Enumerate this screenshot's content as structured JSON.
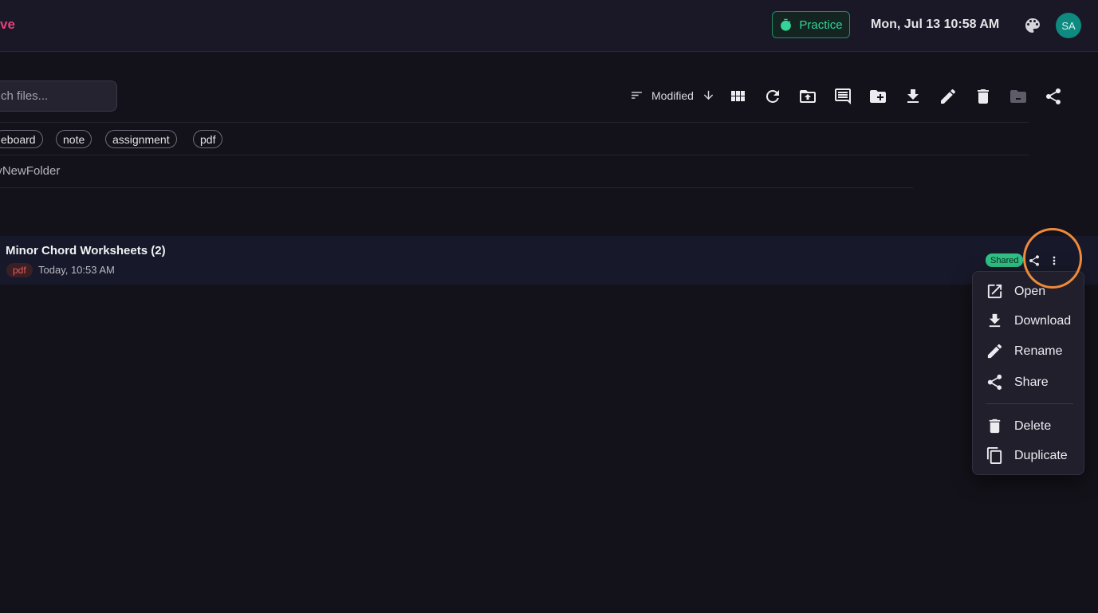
{
  "header": {
    "brand": "ve",
    "practice_label": "Practice",
    "datetime": "Mon, Jul 13 10:58 AM",
    "avatar_initials": "SA"
  },
  "toolbar": {
    "search_placeholder": "ch files...",
    "sort_label": "Modified",
    "icons": [
      "grid-view-icon",
      "refresh-icon",
      "upload-folder-icon",
      "comment-icon",
      "new-folder-icon",
      "download-icon",
      "edit-icon",
      "delete-icon",
      "archive-icon",
      "share-icon"
    ]
  },
  "tags": [
    "eboard",
    "note",
    "assignment",
    "pdf"
  ],
  "breadcrumb": "lyNewFolder",
  "file": {
    "title": "Minor Chord Worksheets (2)",
    "type": "pdf",
    "modified": "Today, 10:53 AM",
    "shared_label": "Shared"
  },
  "context_menu": {
    "items": [
      {
        "label": "Open",
        "icon": "open-external-icon"
      },
      {
        "label": "Download",
        "icon": "download-icon"
      },
      {
        "label": "Rename",
        "icon": "pencil-icon"
      },
      {
        "label": "Share",
        "icon": "share-icon"
      },
      {
        "label": "Delete",
        "icon": "trash-icon"
      },
      {
        "label": "Duplicate",
        "icon": "copy-icon"
      }
    ]
  },
  "colors": {
    "accent_green": "#34d399",
    "brand_pink": "#e0427a",
    "highlight_orange": "#f08a3a",
    "pdf_red": "#ef5a5a"
  }
}
